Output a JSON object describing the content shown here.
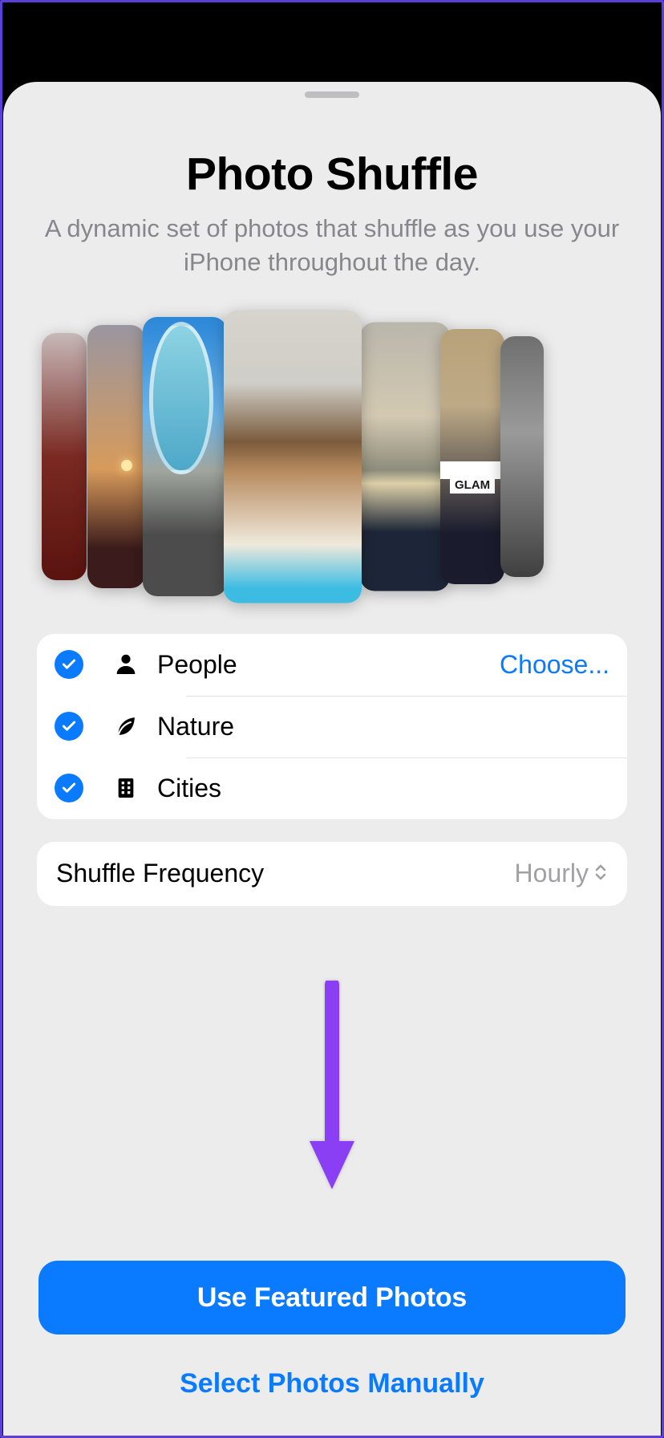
{
  "header": {
    "title": "Photo Shuffle",
    "subtitle": "A dynamic set of photos that shuffle as you use your iPhone throughout the day."
  },
  "categories": {
    "choose_label": "Choose...",
    "items": [
      {
        "label": "People",
        "checked": true,
        "action": true
      },
      {
        "label": "Nature",
        "checked": true,
        "action": false
      },
      {
        "label": "Cities",
        "checked": true,
        "action": false
      }
    ]
  },
  "frequency": {
    "label": "Shuffle Frequency",
    "value": "Hourly"
  },
  "footer": {
    "primary": "Use Featured Photos",
    "secondary": "Select Photos Manually"
  }
}
